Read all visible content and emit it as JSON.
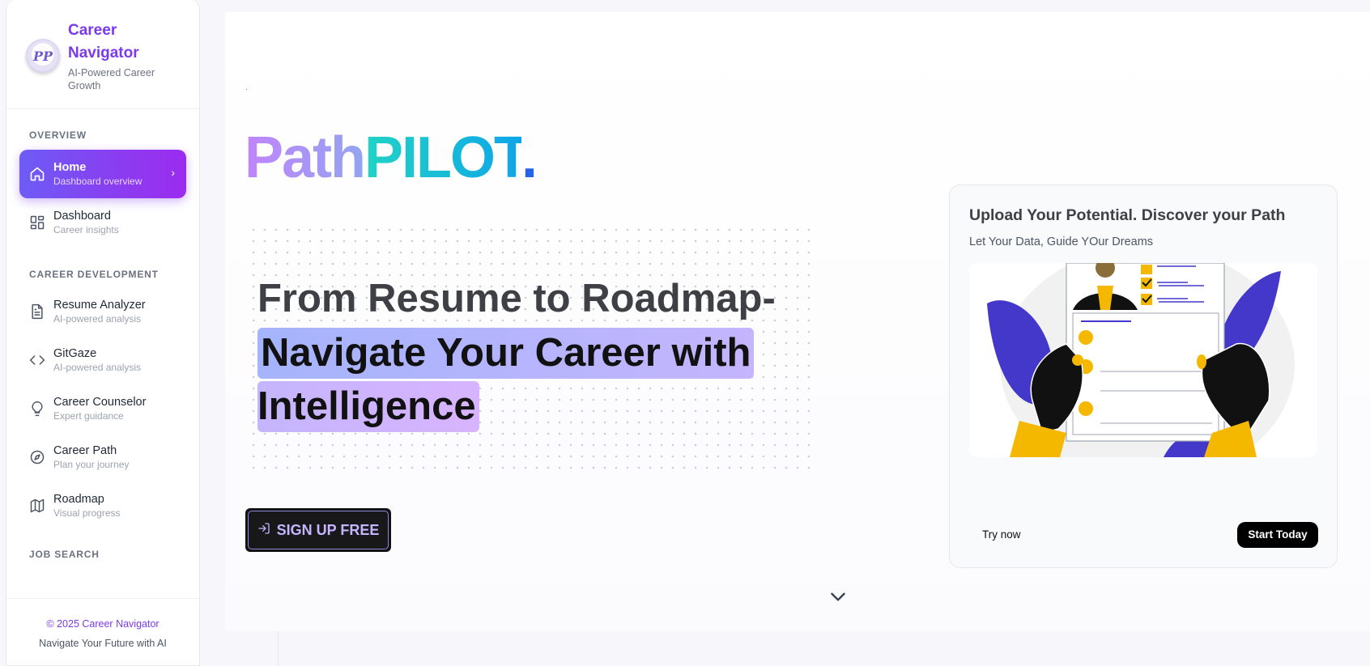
{
  "sidebar": {
    "brand": {
      "title": "Career Navigator",
      "subtitle": "AI-Powered Career Growth",
      "logo_text": "PP"
    },
    "sections": {
      "overview": "OVERVIEW",
      "career_development": "CAREER DEVELOPMENT",
      "job_search": "JOB SEARCH"
    },
    "items": [
      {
        "label": "Home",
        "sub": "Dashboard overview",
        "icon": "home-icon",
        "active": true
      },
      {
        "label": "Dashboard",
        "sub": "Career insights",
        "icon": "grid-icon"
      },
      {
        "label": "Resume Analyzer",
        "sub": "AI-powered analysis",
        "icon": "document-icon"
      },
      {
        "label": "GitGaze",
        "sub": "AI-powered analysis",
        "icon": "code-icon"
      },
      {
        "label": "Career Counselor",
        "sub": "Expert guidance",
        "icon": "lightbulb-icon"
      },
      {
        "label": "Career Path",
        "sub": "Plan your journey",
        "icon": "compass-icon"
      },
      {
        "label": "Roadmap",
        "sub": "Visual progress",
        "icon": "map-icon"
      }
    ],
    "footer": {
      "copyright": "© 2025 Career Navigator",
      "tagline": "Navigate Your Future with AI"
    }
  },
  "main": {
    "dot": ".",
    "logo": {
      "part1": "Path",
      "part2": "PILOT",
      "dot": "."
    },
    "hero": {
      "line1": "From Resume to Roadmap-",
      "line2": "Navigate Your Career with",
      "line3": "Intelligence"
    },
    "signup_label": "SIGN UP FREE"
  },
  "card": {
    "title": "Upload Your Potential. Discover your Path",
    "subtitle": "Let Your Data, Guide YOur Dreams",
    "try_label": "Try now",
    "start_label": "Start Today"
  },
  "colors": {
    "accent": "#7c3aed",
    "active_gradient_start": "#6d5cf6",
    "active_gradient_end": "#9b2cf0",
    "illustration_purple": "#4338ca",
    "illustration_yellow": "#f5b800"
  }
}
